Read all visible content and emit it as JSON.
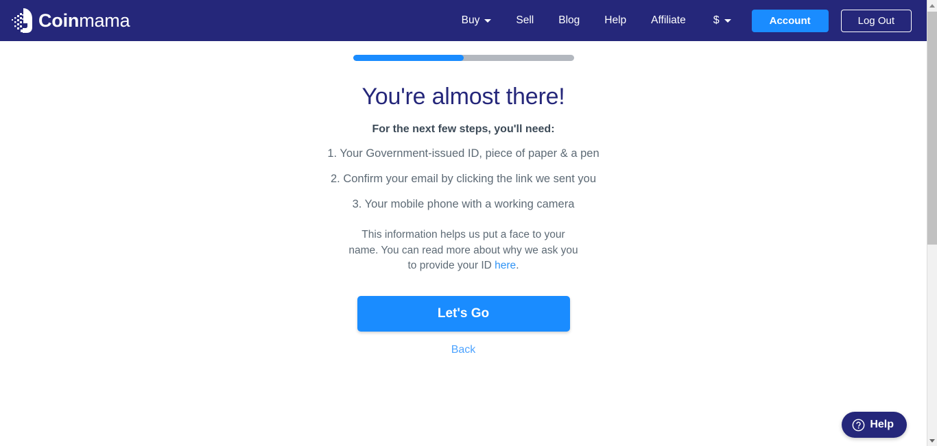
{
  "navbar": {
    "brand": {
      "icon": "coinmama-face-logo-icon",
      "bold_part": "Coin",
      "light_part": "mama"
    },
    "links": [
      {
        "label": "Buy",
        "has_caret": true
      },
      {
        "label": "Sell",
        "has_caret": false
      },
      {
        "label": "Blog",
        "has_caret": false
      },
      {
        "label": "Help",
        "has_caret": false
      },
      {
        "label": "Affiliate",
        "has_caret": false
      }
    ],
    "currency": {
      "label": "$",
      "has_caret": true
    },
    "account_button": "Account",
    "logout_button": "Log Out"
  },
  "progress": {
    "percent": 50
  },
  "main": {
    "headline": "You're almost there!",
    "subheadline": "For the next few steps, you'll need:",
    "steps": [
      "1. Your Government-issued ID, piece of paper & a pen",
      "2. Confirm your email by clicking the link we sent you",
      "3. Your mobile phone with a working camera"
    ],
    "explain_before": "This information helps us put a face to your name. You can read more about why we ask you to provide your ID ",
    "explain_link": "here",
    "explain_after": ".",
    "cta_label": "Let's Go",
    "back_label": "Back"
  },
  "help_widget": {
    "icon": "question-mark-circle-icon",
    "label": "Help"
  },
  "colors": {
    "navy": "#25277a",
    "accent_blue": "#1a8cff",
    "link_blue": "#4da3ff",
    "body_text": "#5d6a75",
    "progress_track": "#b3b8bf"
  }
}
